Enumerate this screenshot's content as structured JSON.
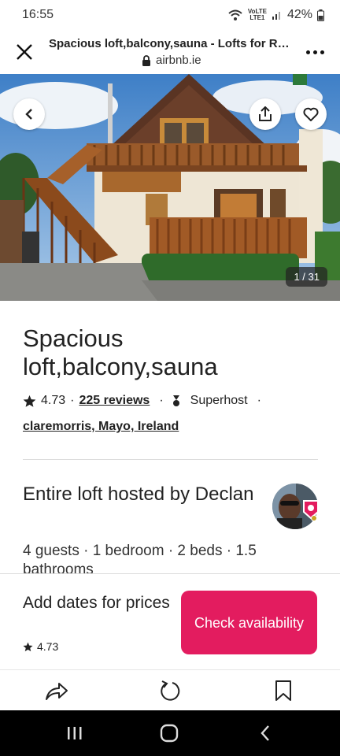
{
  "status_bar": {
    "time": "16:55",
    "network_top": "VoLTE",
    "network_bottom": "LTE1",
    "battery": "42%"
  },
  "browser": {
    "page_title": "Spacious loft,balcony,sauna - Lofts for Re...",
    "domain": "airbnb.ie"
  },
  "photo": {
    "counter": "1 / 31"
  },
  "listing": {
    "title": "Spacious loft,balcony,sauna",
    "rating": "4.73",
    "reviews": "225 reviews",
    "dot": "·",
    "superhost": "Superhost",
    "location": "claremorris, Mayo, Ireland",
    "host_title": "Entire loft hosted by Declan",
    "details": "4 guests · 1 bedroom · 2 beds · 1.5 bathrooms"
  },
  "booking": {
    "add_dates": "Add dates for prices",
    "rating": "4.73",
    "button": "Check availability"
  },
  "colors": {
    "accent": "#e31c5f",
    "text": "#222222",
    "navbar": "#000000"
  },
  "icons": {
    "close": "close-icon",
    "menu": "more-vert-icon",
    "back": "chevron-left-icon",
    "share": "share-icon",
    "heart": "heart-icon",
    "star": "star-icon",
    "superhost": "superhost-icon",
    "share_toolbar": "share-arrow-icon",
    "refresh": "refresh-icon",
    "bookmark": "bookmark-icon"
  }
}
